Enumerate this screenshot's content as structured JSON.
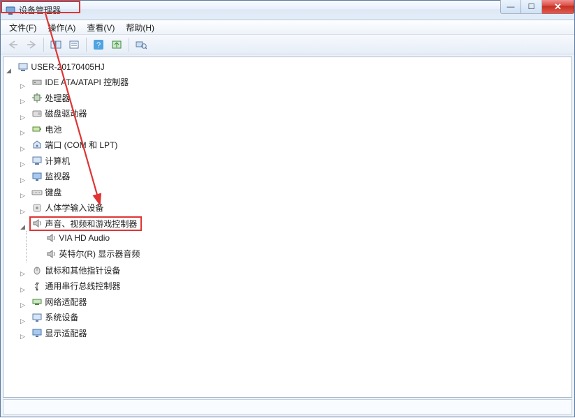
{
  "window": {
    "title": "设备管理器"
  },
  "menu": {
    "file": "文件(F)",
    "action": "操作(A)",
    "view": "查看(V)",
    "help": "帮助(H)"
  },
  "tree": {
    "root": "USER-20170405HJ",
    "ide": "IDE ATA/ATAPI 控制器",
    "cpu": "处理器",
    "disk": "磁盘驱动器",
    "battery": "电池",
    "ports": "端口 (COM 和 LPT)",
    "computer": "计算机",
    "monitor": "监视器",
    "keyboard": "键盘",
    "hid": "人体学输入设备",
    "sound": "声音、视频和游戏控制器",
    "sound_child1": "VIA HD Audio",
    "sound_child2": "英特尔(R) 显示器音频",
    "mouse": "鼠标和其他指针设备",
    "usb": "通用串行总线控制器",
    "network": "网络适配器",
    "system": "系统设备",
    "display": "显示适配器"
  },
  "icons": {
    "app": "device-manager-icon",
    "computer": "computer-icon",
    "ide": "ide-icon",
    "cpu": "cpu-icon",
    "disk": "disk-icon",
    "battery": "battery-icon",
    "port": "port-icon",
    "monitor": "monitor-icon",
    "keyboard": "keyboard-icon",
    "hid": "hid-icon",
    "speaker": "speaker-icon",
    "mouse": "mouse-icon",
    "usb": "usb-icon",
    "network": "network-icon",
    "system": "system-icon",
    "display": "display-icon"
  },
  "colors": {
    "highlight": "#e03434"
  }
}
